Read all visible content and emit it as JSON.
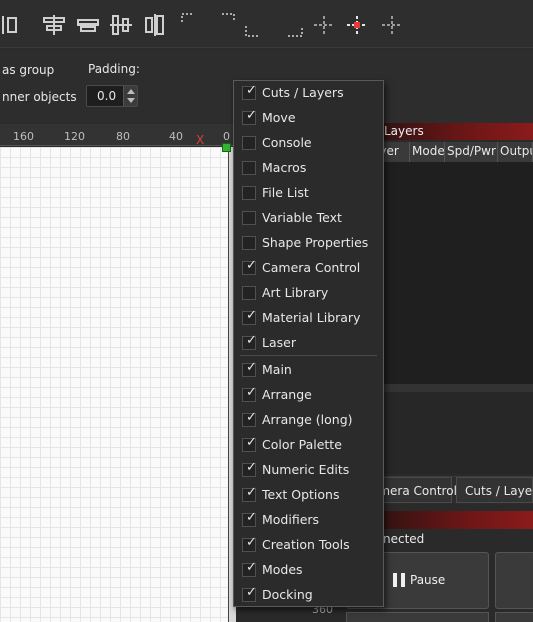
{
  "options": {
    "group_label": "as group",
    "inner_label": "nner objects",
    "padding_label": "Padding:",
    "padding_value": "0.0"
  },
  "ruler": {
    "marks": [
      "160",
      "120",
      "80",
      "40",
      "0"
    ],
    "x_marker": "X",
    "v_number": "360"
  },
  "layers_panel": {
    "title": "Layers",
    "columns": [
      "ayer",
      "Mode",
      "Spd/Pwr",
      "Outpu"
    ]
  },
  "tabs": [
    "amera Control",
    "Cuts / Layers"
  ],
  "laser": {
    "status": "nected",
    "pause_label": "Pause"
  },
  "context_menu": {
    "windows": [
      {
        "label": "Cuts / Layers",
        "checked": true
      },
      {
        "label": "Move",
        "checked": true
      },
      {
        "label": "Console",
        "checked": false
      },
      {
        "label": "Macros",
        "checked": false
      },
      {
        "label": "File List",
        "checked": false
      },
      {
        "label": "Variable Text",
        "checked": false
      },
      {
        "label": "Shape Properties",
        "checked": false
      },
      {
        "label": "Camera Control",
        "checked": true
      },
      {
        "label": "Art Library",
        "checked": false
      },
      {
        "label": "Material Library",
        "checked": true
      },
      {
        "label": "Laser",
        "checked": true
      }
    ],
    "toolbars": [
      {
        "label": "Main",
        "checked": true
      },
      {
        "label": "Arrange",
        "checked": true
      },
      {
        "label": "Arrange (long)",
        "checked": true
      },
      {
        "label": "Color Palette",
        "checked": true
      },
      {
        "label": "Numeric Edits",
        "checked": true
      },
      {
        "label": "Text Options",
        "checked": true
      },
      {
        "label": "Modifiers",
        "checked": true
      },
      {
        "label": "Creation Tools",
        "checked": true
      },
      {
        "label": "Modes",
        "checked": true
      },
      {
        "label": "Docking",
        "checked": true
      }
    ],
    "check_glyph": "✓"
  },
  "colors": {
    "accent_red": "#8a1b1b",
    "origin_green": "#31b531",
    "marker_red": "#d0423d"
  }
}
